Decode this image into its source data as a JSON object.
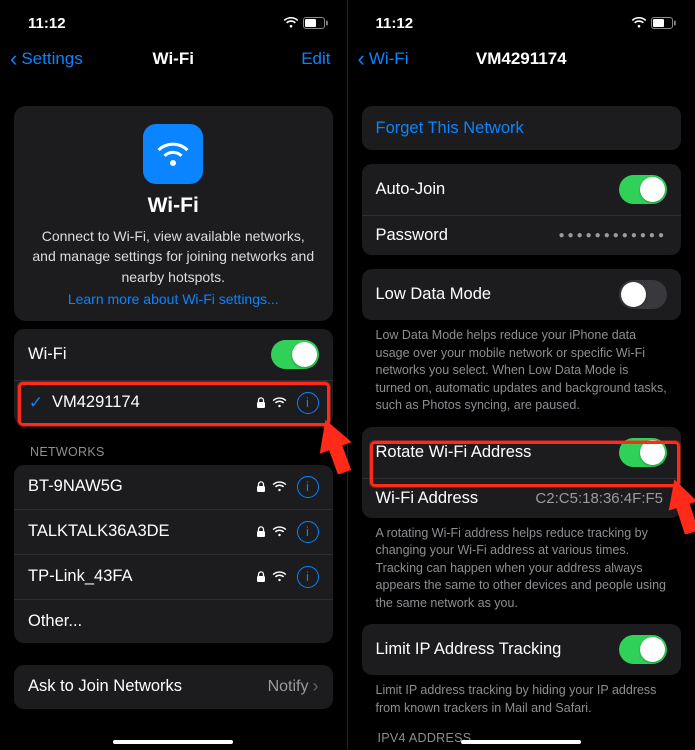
{
  "left": {
    "status": {
      "time": "11:12"
    },
    "nav": {
      "back": "Settings",
      "title": "Wi-Fi",
      "right": "Edit"
    },
    "card": {
      "title": "Wi-Fi",
      "desc": "Connect to Wi-Fi, view available networks, and manage settings for joining networks and nearby hotspots.",
      "link": "Learn more about Wi-Fi settings..."
    },
    "wifi_toggle": {
      "label": "Wi-Fi",
      "on": true
    },
    "connected": {
      "ssid": "VM4291174"
    },
    "section_networks": "Networks",
    "networks": [
      {
        "ssid": "BT-9NAW5G"
      },
      {
        "ssid": "TALKTALK36A3DE"
      },
      {
        "ssid": "TP-Link_43FA"
      },
      {
        "ssid": "Other..."
      }
    ],
    "ask": {
      "label": "Ask to Join Networks",
      "value": "Notify"
    }
  },
  "right": {
    "status": {
      "time": "11:12"
    },
    "nav": {
      "back": "Wi-Fi",
      "title": "VM4291174"
    },
    "forget": "Forget This Network",
    "auto_join": {
      "label": "Auto-Join",
      "on": true
    },
    "password": {
      "label": "Password"
    },
    "low_data": {
      "label": "Low Data Mode",
      "on": false
    },
    "low_data_desc": "Low Data Mode helps reduce your iPhone data usage over your mobile network or specific Wi-Fi networks you select. When Low Data Mode is turned on, automatic updates and background tasks, such as Photos syncing, are paused.",
    "rotate": {
      "label": "Rotate Wi-Fi Address",
      "on": true
    },
    "wifi_addr": {
      "label": "Wi-Fi Address",
      "value": "C2:C5:18:36:4F:F5"
    },
    "rotate_desc": "A rotating Wi-Fi address helps reduce tracking by changing your Wi-Fi address at various times. Tracking can happen when your address always appears the same to other devices and people using the same network as you.",
    "limit_ip": {
      "label": "Limit IP Address Tracking",
      "on": true
    },
    "limit_ip_desc": "Limit IP address tracking by hiding your IP address from known trackers in Mail and Safari.",
    "ipv4_header": "IPV4 Address"
  }
}
